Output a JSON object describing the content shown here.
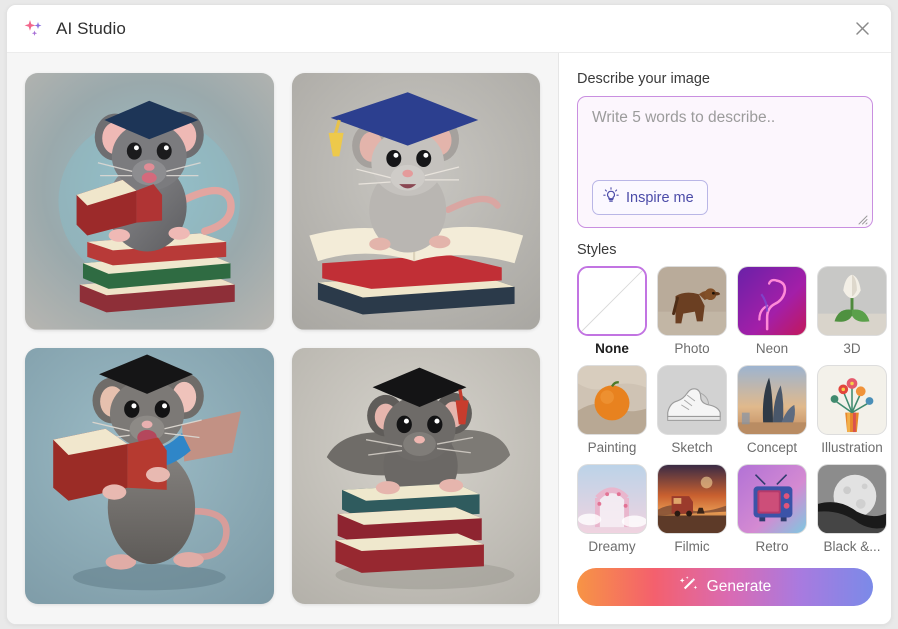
{
  "window": {
    "title": "AI Studio",
    "app_icon": "sparkles-icon",
    "close_icon": "close-icon"
  },
  "gallery": {
    "images": [
      {
        "name": "mouse-graduate-reading-on-book-stack",
        "alt": "3D mouse with graduation cap reading a red book on a stack of books"
      },
      {
        "name": "mouse-graduate-on-open-book",
        "alt": "3D mouse with blue mortarboard and yellow tassel sitting on an open book"
      },
      {
        "name": "mouse-graduate-standing-with-book",
        "alt": "3D mouse with graduation cap and blue sash holding an open red book"
      },
      {
        "name": "winged-mouse-graduate-on-books",
        "alt": "3D winged mouse with graduation cap behind a stack of three books"
      }
    ]
  },
  "prompt": {
    "label": "Describe your image",
    "placeholder": "Write 5 words to describe..",
    "value": "",
    "inspire_label": "Inspire me",
    "inspire_icon": "lightbulb-icon",
    "resize_handle": "resize-grip-icon",
    "border_color": "#c98fe0"
  },
  "styles": {
    "label": "Styles",
    "selected": "None",
    "items": [
      {
        "label": "None",
        "icon": "none-diagonal-icon",
        "selected": true
      },
      {
        "label": "Photo",
        "icon": "dog-photo-thumb",
        "selected": false
      },
      {
        "label": "Neon",
        "icon": "neon-flamingo-thumb",
        "selected": false
      },
      {
        "label": "3D",
        "icon": "tulip-3d-thumb",
        "selected": false
      },
      {
        "label": "Painting",
        "icon": "orange-painting-thumb",
        "selected": false
      },
      {
        "label": "Sketch",
        "icon": "sneaker-sketch-thumb",
        "selected": false
      },
      {
        "label": "Concept",
        "icon": "concept-building-thumb",
        "selected": false
      },
      {
        "label": "Illustration",
        "icon": "flower-vase-illustration-thumb",
        "selected": false
      },
      {
        "label": "Dreamy",
        "icon": "dreamy-arch-thumb",
        "selected": false
      },
      {
        "label": "Filmic",
        "icon": "filmic-sunset-van-thumb",
        "selected": false
      },
      {
        "label": "Retro",
        "icon": "retro-tv-thumb",
        "selected": false
      },
      {
        "label": "Black &...",
        "icon": "moon-black-white-thumb",
        "selected": false
      }
    ]
  },
  "generate": {
    "label": "Generate",
    "icon": "magic-wand-icon",
    "gradient": "#f79445 → #f4606d → #d96bb4 → #a97adf → #7b8ae8"
  }
}
